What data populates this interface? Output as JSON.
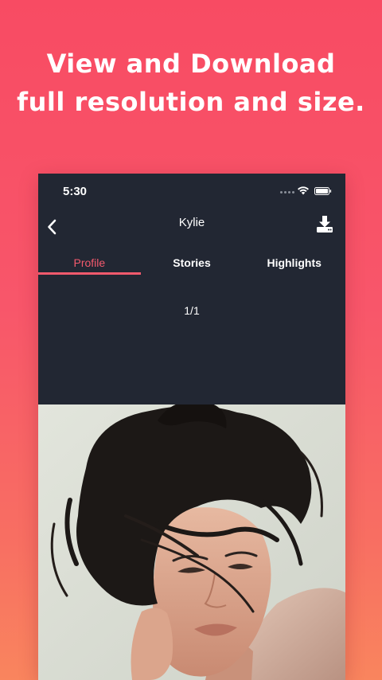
{
  "headline": {
    "line1": "View and Download",
    "line2": "full resolution and size."
  },
  "status_bar": {
    "time": "5:30"
  },
  "nav": {
    "title": "Kylie",
    "back_icon": "chevron-left-icon",
    "download_icon": "download-icon"
  },
  "tabs": [
    {
      "label": "Profile",
      "active": true
    },
    {
      "label": "Stories",
      "active": false
    },
    {
      "label": "Highlights",
      "active": false
    }
  ],
  "viewer": {
    "counter": "1/1"
  },
  "colors": {
    "background_top": "#f84b63",
    "background_bottom": "#f9855e",
    "device_bg": "#222733",
    "accent": "#f45a6d",
    "text": "#ffffff"
  }
}
